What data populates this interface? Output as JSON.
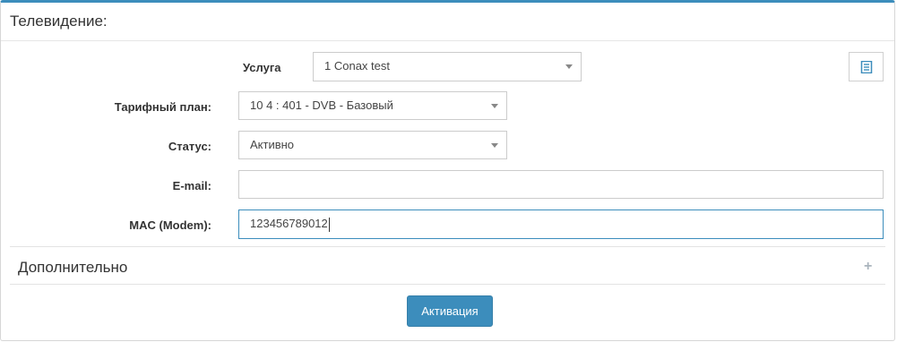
{
  "panel": {
    "title": "Телевидение:"
  },
  "form": {
    "service": {
      "label": "Услуга",
      "value": "1 Conax test"
    },
    "tariff": {
      "label": "Тарифный план:",
      "value": "10 4 : 401 - DVB - Базовый"
    },
    "status": {
      "label": "Статус:",
      "value": "Активно"
    },
    "email": {
      "label": "E-mail:",
      "value": ""
    },
    "mac": {
      "label": "MAC (Modem):",
      "value": "123456789012"
    }
  },
  "extra": {
    "title": "Дополнительно",
    "toggle_icon": "+"
  },
  "actions": {
    "activate_label": "Активация"
  },
  "colors": {
    "accent": "#3c8dbc"
  },
  "icons": {
    "list": "list-icon",
    "expand": "plus-icon"
  }
}
